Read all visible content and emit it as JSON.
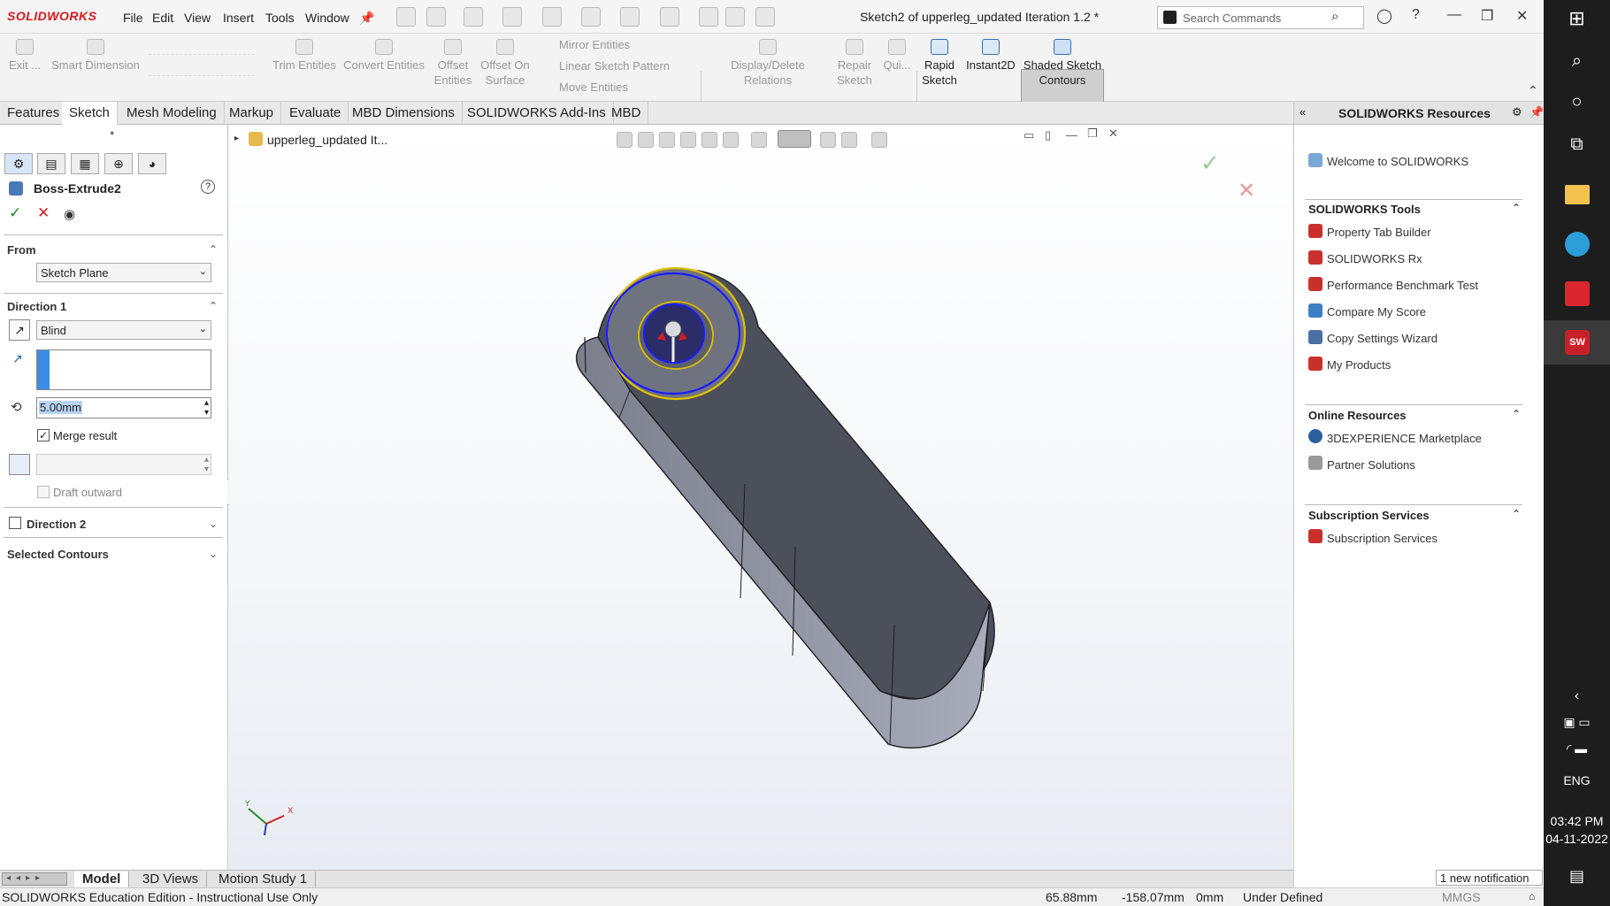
{
  "app": {
    "logo": "SOLIDWORKS",
    "window_title": "Sketch2 of upperleg_updated Iteration 1.2 *"
  },
  "menu": [
    "File",
    "Edit",
    "View",
    "Insert",
    "Tools",
    "Window"
  ],
  "search": {
    "placeholder": "Search Commands"
  },
  "ribbon": {
    "exit": "Exit ...",
    "smart_dimension": "Smart Dimension",
    "trim_entities": "Trim Entities",
    "convert_entities": "Convert Entities",
    "offset_entities_1": "Offset",
    "offset_entities_2": "Entities",
    "offset_surface_1": "Offset On",
    "offset_surface_2": "Surface",
    "mirror_entities": "Mirror Entities",
    "linear_pattern": "Linear Sketch Pattern",
    "move_entities": "Move Entities",
    "display_delete": "Display/Delete Relations",
    "repair_1": "Repair",
    "repair_2": "Sketch",
    "quick": "Qui...",
    "rapid_1": "Rapid",
    "rapid_2": "Sketch",
    "instant2d": "Instant2D",
    "shaded_1": "Shaded Sketch",
    "shaded_2": "Contours"
  },
  "tabs": [
    "Features",
    "Sketch",
    "Mesh Modeling",
    "Markup",
    "Evaluate",
    "MBD Dimensions",
    "SOLIDWORKS Add-Ins",
    "MBD"
  ],
  "property_manager": {
    "feature_name": "Boss-Extrude2",
    "from_label": "From",
    "from_value": "Sketch Plane",
    "direction1_label": "Direction 1",
    "direction1_type": "Blind",
    "depth_value": "5.00mm",
    "merge_result": "Merge result",
    "draft_outward": "Draft outward",
    "direction2_label": "Direction 2",
    "selected_contours_label": "Selected Contours"
  },
  "tree": {
    "root": "upperleg_updated It..."
  },
  "resources": {
    "header": "SOLIDWORKS Resources",
    "welcome": "Welcome to SOLIDWORKS",
    "tools_header": "SOLIDWORKS Tools",
    "tools": [
      "Property Tab Builder",
      "SOLIDWORKS Rx",
      "Performance Benchmark Test",
      "Compare My Score",
      "Copy Settings Wizard",
      "My Products"
    ],
    "online_header": "Online Resources",
    "online": [
      "3DEXPERIENCE Marketplace",
      "Partner Solutions"
    ],
    "subscription_header": "Subscription Services",
    "subscription": [
      "Subscription Services"
    ]
  },
  "bottom_tabs": [
    "Model",
    "3D Views",
    "Motion Study 1"
  ],
  "status": {
    "edition": "SOLIDWORKS Education Edition - Instructional Use Only",
    "x": "65.88mm",
    "y": "-158.07mm",
    "z": "0mm",
    "state": "Under Defined",
    "units": "MMGS",
    "notification": "1 new notification"
  },
  "taskbar": {
    "lang": "ENG",
    "time": "03:42 PM",
    "date": "04-11-2022"
  },
  "triad": {
    "y": "Y",
    "x": "X"
  },
  "colors": {
    "accent_red": "#d71920",
    "sketch_blue": "#1a1aff",
    "sketch_yellow": "#e0c000",
    "body_gray": "#5a5e68"
  }
}
